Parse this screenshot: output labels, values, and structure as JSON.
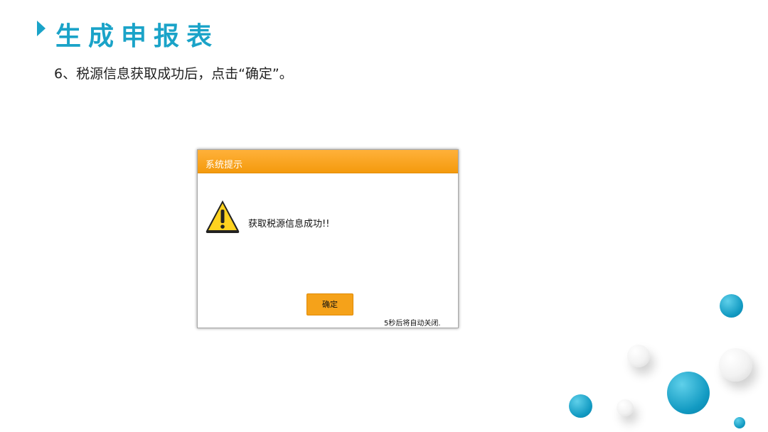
{
  "slide": {
    "title": "生成申报表",
    "instruction": "6、税源信息获取成功后，点击“确定”。"
  },
  "dialog": {
    "title": "系统提示",
    "message": "获取税源信息成功!!",
    "ok_button": "确定",
    "countdown": "5秒后将自动关闭."
  },
  "colors": {
    "accent": "#1aa3c8",
    "dialog_titlebar": "#f5a21a",
    "button": "#f5a21a"
  },
  "icons": {
    "dialog_icon": "warning-icon"
  }
}
